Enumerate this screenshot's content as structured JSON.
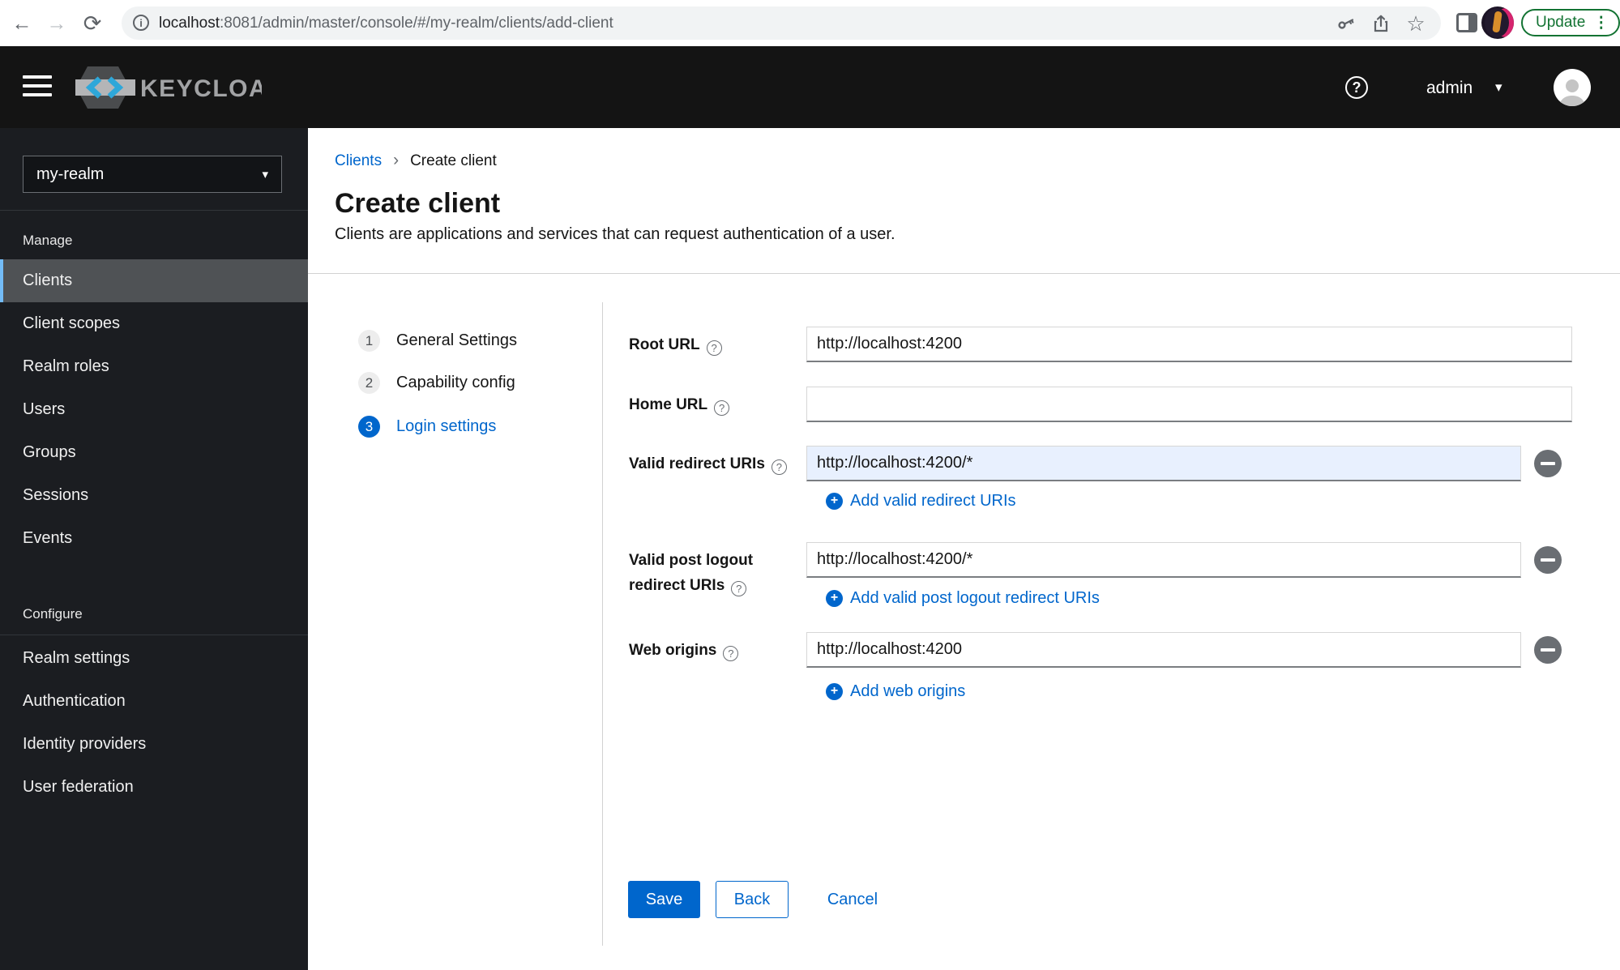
{
  "browser": {
    "url_host": "localhost",
    "url_rest": ":8081/admin/master/console/#/my-realm/clients/add-client",
    "update_label": "Update"
  },
  "masthead": {
    "brand": "KEYCLOAK",
    "user": "admin"
  },
  "sidebar": {
    "realm": "my-realm",
    "manage_label": "Manage",
    "manage_items": [
      "Clients",
      "Client scopes",
      "Realm roles",
      "Users",
      "Groups",
      "Sessions",
      "Events"
    ],
    "active_item": "Clients",
    "configure_label": "Configure",
    "configure_items": [
      "Realm settings",
      "Authentication",
      "Identity providers",
      "User federation"
    ]
  },
  "breadcrumb": {
    "parent": "Clients",
    "current": "Create client"
  },
  "page": {
    "title": "Create client",
    "subtitle": "Clients are applications and services that can request authentication of a user."
  },
  "wizard": {
    "steps": [
      {
        "num": "1",
        "label": "General Settings"
      },
      {
        "num": "2",
        "label": "Capability config"
      },
      {
        "num": "3",
        "label": "Login settings",
        "active": true
      }
    ]
  },
  "form": {
    "fields": [
      {
        "label": "Root URL",
        "value": "http://localhost:4200"
      },
      {
        "label": "Home URL",
        "value": ""
      },
      {
        "label": "Valid redirect URIs",
        "value": "http://localhost:4200/*",
        "add_label": "Add valid redirect URIs"
      },
      {
        "label": "Valid post logout redirect URIs",
        "value": "http://localhost:4200/*",
        "add_label": "Add valid post logout redirect URIs"
      },
      {
        "label": "Web origins",
        "value": "http://localhost:4200",
        "add_label": "Add web origins"
      }
    ],
    "actions": {
      "save": "Save",
      "back": "Back",
      "cancel": "Cancel"
    }
  },
  "icons": {
    "back": "←",
    "forward": "→",
    "reload": "⟳",
    "star": "☆",
    "kebab": "⋮",
    "caret_down": "▾",
    "chevron_right": "›",
    "help": "?",
    "plus": "+",
    "info": "i"
  },
  "colors": {
    "accent_blue": "#0066cc",
    "nav_active_border": "#73bcf7",
    "update_green": "#137333",
    "masthead_bg": "#141414",
    "sidebar_bg": "#1b1d21",
    "focused_input_bg": "#e8f0fe",
    "logo_blue": "#2ea7d9"
  }
}
